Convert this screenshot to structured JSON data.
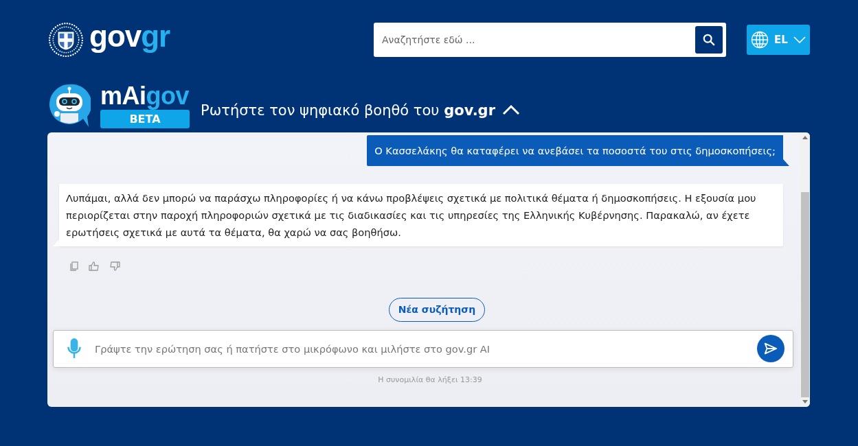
{
  "header": {
    "logo": {
      "main": "gov",
      "accent": "gr"
    },
    "search": {
      "placeholder": "Αναζητήστε εδώ ..."
    },
    "language": {
      "code": "EL"
    }
  },
  "assistant": {
    "name": {
      "main": "mAi",
      "accent": "gov"
    },
    "badge": "BETA",
    "title": "Ρωτήστε τον ψηφιακό βοηθό του **gov.gr**",
    "expanded": true
  },
  "messages": [
    {
      "kind": "user",
      "text": "Ο Κασσελάκης θα καταφέρει να ανεβάσει τα ποσοστά του στις δημοσκοπήσεις;"
    },
    {
      "kind": "bot",
      "text": "Λυπάμαι, αλλά δεν μπορώ να παράσχω πληροφορίες ή να κάνω προβλέψεις σχετικά με πολιτικά θέματα ή δημοσκοπήσεις. Η εξουσία μου περιορίζεται στην παροχή πληροφοριών σχετικά με τις διαδικασίες και τις υπηρεσίες της Ελληνικής Κυβέρνησης. Παρακαλώ, αν έχετε ερωτήσεις σχετικά με αυτά τα θέματα, θα χαρώ να σας βοηθήσω."
    }
  ],
  "new_chat_button": "Νέα συζήτηση",
  "composer": {
    "placeholder": "Γράψτε την ερώτηση σας ή πατήστε στο μικρόφωνο και μιλήστε στο gov.gr AI"
  },
  "session_note": "Η συνομιλία θα λήξει 13:39"
}
